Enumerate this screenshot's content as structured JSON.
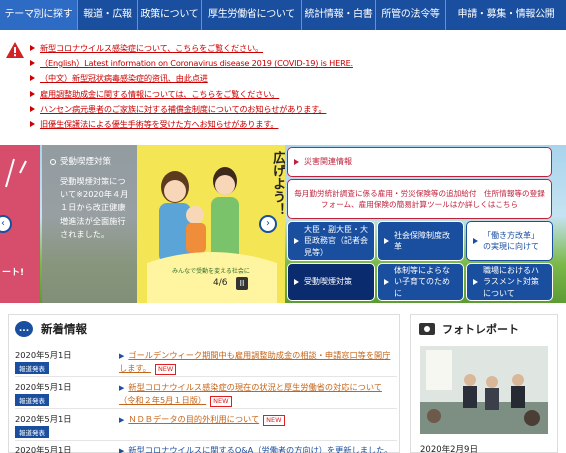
{
  "nav": {
    "items": [
      "テーマ別に探す",
      "報道・広報",
      "政策について",
      "厚生労働省について",
      "統計情報・白書",
      "所管の法令等",
      "申請・募集・情報公開"
    ]
  },
  "alerts": [
    "新型コロナウイルス感染症について、こちらをご覧ください。",
    "（English）Latest information on Coronavirus disease 2019 (COVID-19) is HERE.",
    "（中文）新型冠状病毒感染症的资讯、由此点进",
    "雇用調整助成金に関する情報については、こちらをご覧ください。",
    "ハンセン病元患者のご家族に対する補償金制度についてのお知らせがあります。",
    "旧優生保護法による優生手術等を受けた方へお知らせがあります。"
  ],
  "hero": {
    "slide_title": "受動喫煙対策",
    "slide_body": "受動喫煙対策について※2020年４月１日から改正健康増進法が全面施行されました。",
    "left_text": "ート!",
    "illus_text": "広げよう！",
    "illus_sub": "みんなで受動を変える社会に",
    "counter": "4/6",
    "pause": "II",
    "prev": "‹",
    "next": "›"
  },
  "quick": {
    "disaster": "災害関連情報",
    "monthly": "毎月勤労統計調査に係る雇用・労災保険等の追加給付　住所情報等の登録フォーム、雇用保険の簡易計算ツールはか詳しくはこちら",
    "minister": "大臣・副大臣・大臣政務官（記者会見等）",
    "social": "社会保障制度改革",
    "work": "「働き方改革」の実現に向けて",
    "smoking": "受動喫煙対策",
    "childcare": "体制等によらない子育てのために",
    "harass": "職場におけるハラスメント対策について"
  },
  "news": {
    "title": "新着情報",
    "icon": "...",
    "rows": [
      {
        "date": "2020年5月1日",
        "badge": "報道発表",
        "text": "ゴールデンウィーク期間中も雇用調整助成金の相談・申請窓口等を開庁します。",
        "new": "NEW"
      },
      {
        "date": "2020年5月1日",
        "badge": "報道発表",
        "text": "新型コロナウイルス感染症の現在の状況と厚生労働省の対応について（令和２年5月１日版）",
        "new": "NEW"
      },
      {
        "date": "2020年5月1日",
        "badge": "報道発表",
        "text": "ＮＤＢデータの目的外利用について",
        "new": "NEW"
      },
      {
        "date": "2020年5月1日",
        "badge": "",
        "text": "新型コロナウイルスに関するQ&A（労働者の方向け）を更新しました。",
        "new": ""
      }
    ]
  },
  "photo": {
    "title": "フォトレポート",
    "date": "2020年2月9日"
  }
}
